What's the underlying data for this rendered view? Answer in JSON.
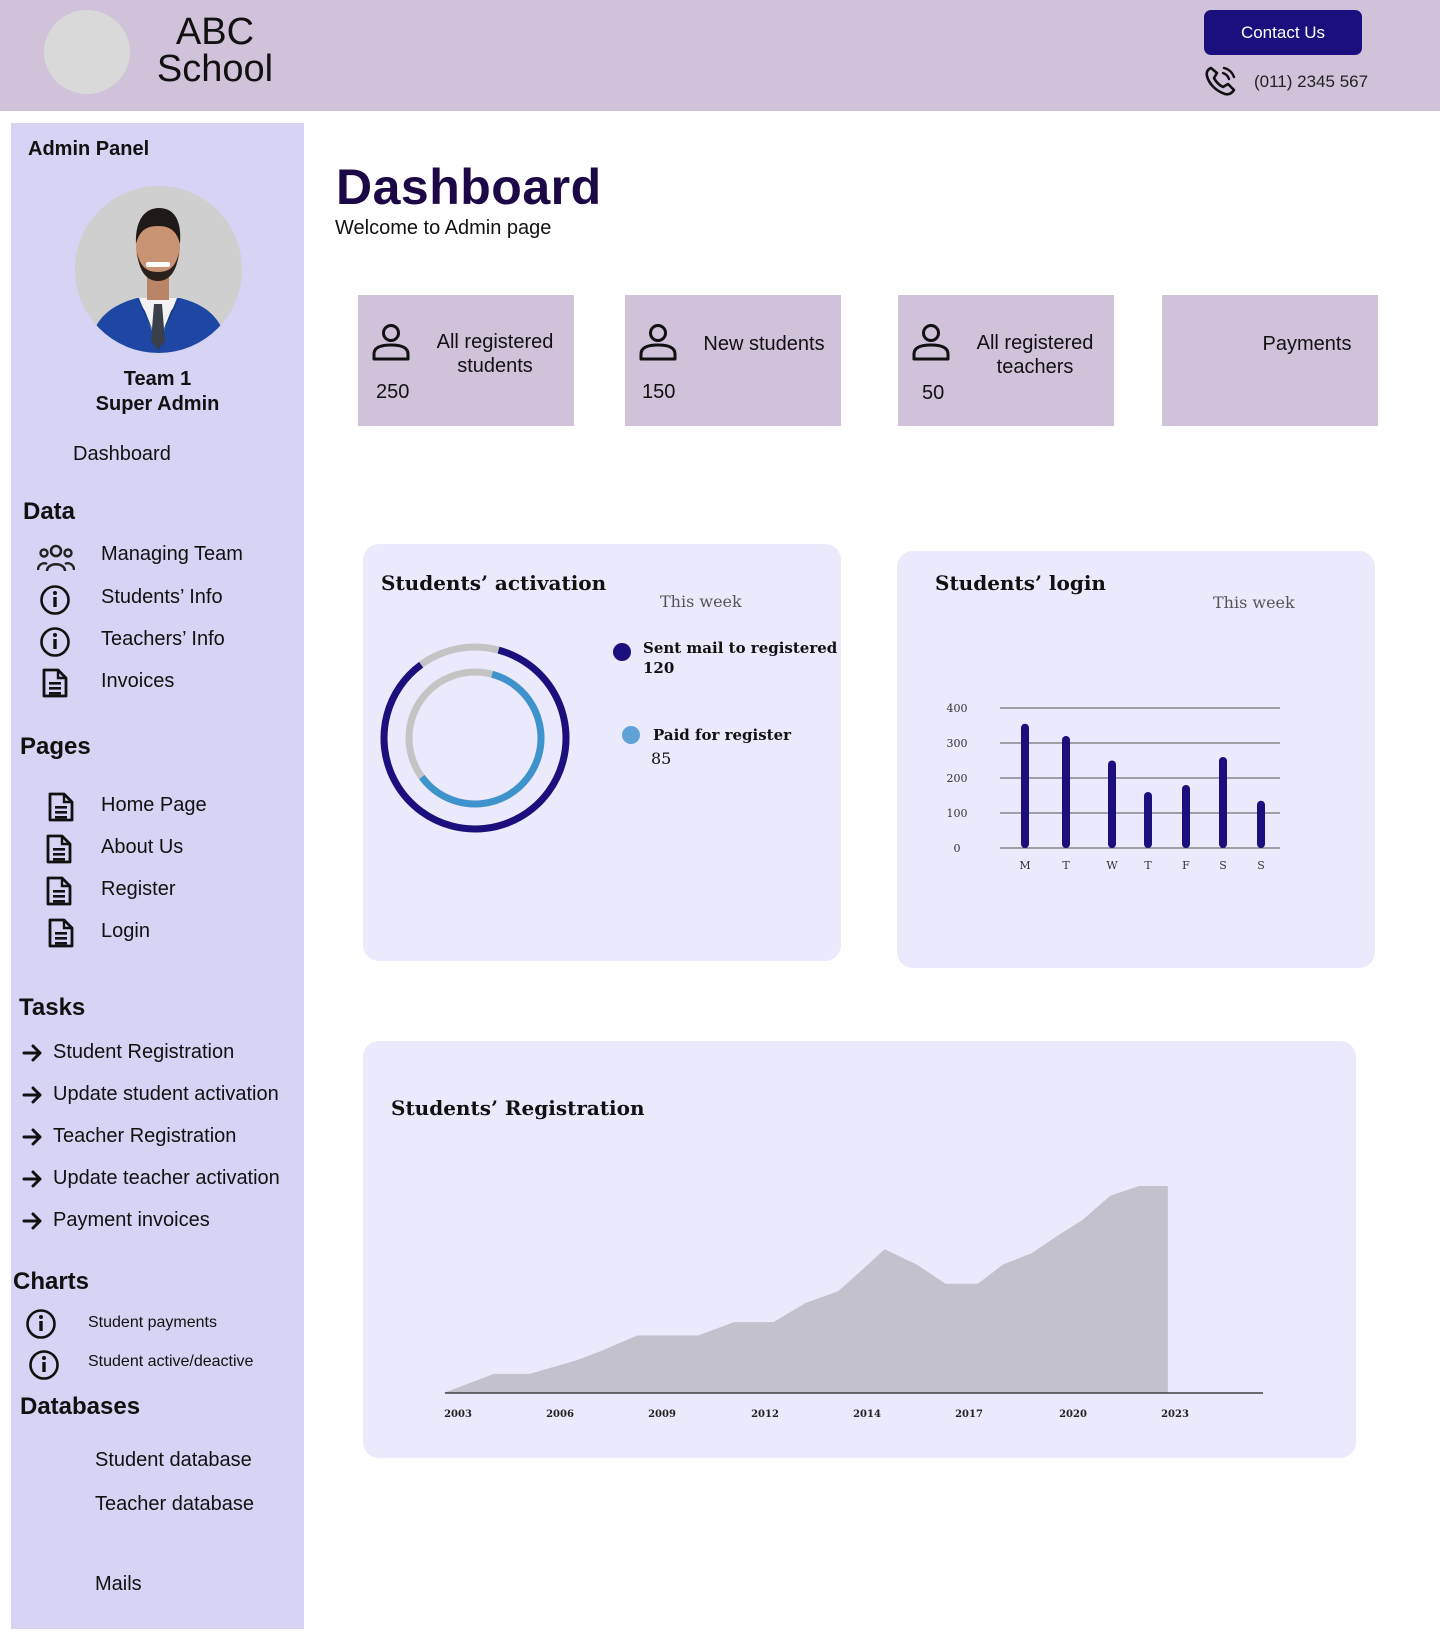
{
  "header": {
    "school_name": "ABC School",
    "contact_button": "Contact Us",
    "phone": "(011) 2345 567"
  },
  "sidebar": {
    "panel_title": "Admin Panel",
    "user_team": "Team 1",
    "user_role": "Super Admin",
    "dashboard_link": "Dashboard",
    "data_heading": "Data",
    "data_items": [
      "Managing Team",
      "Students’ Info",
      "Teachers’ Info",
      "Invoices"
    ],
    "pages_heading": "Pages",
    "pages_items": [
      "Home Page",
      "About Us",
      "Register",
      "Login"
    ],
    "tasks_heading": "Tasks",
    "tasks_items": [
      "Student Registration",
      "Update student activation",
      "Teacher Registration",
      "Update teacher activation",
      "Payment invoices"
    ],
    "charts_heading": "Charts",
    "charts_items": [
      "Student payments",
      "Student active/deactive"
    ],
    "databases_heading": "Databases",
    "databases_items": [
      "Student database",
      "Teacher database",
      "Mails"
    ]
  },
  "main": {
    "title": "Dashboard",
    "subtitle": "Welcome to Admin page",
    "cards": [
      {
        "label_line1": "All registered",
        "label_line2": "students",
        "value": "250"
      },
      {
        "label_line1": "New students",
        "label_line2": "",
        "value": "150"
      },
      {
        "label_line1": "All registered",
        "label_line2": "teachers",
        "value": "50"
      },
      {
        "label_line1": "Payments",
        "label_line2": "",
        "value": ""
      }
    ]
  },
  "activation": {
    "title": "Students’ activation",
    "period": "This week",
    "legend1_label": "Sent mail to registered",
    "legend1_value": "120",
    "legend2_label": "Paid for register",
    "legend2_value": "85"
  },
  "login": {
    "title": "Students’ login",
    "period": "This week"
  },
  "registration": {
    "title": "Students’ Registration"
  },
  "colors": {
    "header_bg": "#cfc2d9",
    "sidebar_bg": "#d6d3f4",
    "panel_bg": "#ebe9fc",
    "accent": "#1b0f7d",
    "light_blue": "#3f93cc",
    "area_fill": "#c3c1cc"
  },
  "chart_data": [
    {
      "type": "pie",
      "title": "Students’ activation",
      "subtitle": "This week",
      "series": [
        {
          "name": "Sent mail to registered",
          "value": 120,
          "color": "#1b0f7d"
        },
        {
          "name": "Paid for register",
          "value": 85,
          "color": "#3f93cc"
        }
      ],
      "max_value": 140
    },
    {
      "type": "bar",
      "title": "Students’ login",
      "subtitle": "This week",
      "categories": [
        "M",
        "T",
        "W",
        "T",
        "F",
        "S",
        "S"
      ],
      "values": [
        355,
        320,
        250,
        160,
        180,
        260,
        135
      ],
      "yticks": [
        "0",
        "100",
        "200",
        "300",
        "400"
      ],
      "ylim": [
        0,
        400
      ],
      "grid": true
    },
    {
      "type": "area",
      "title": "Students’ Registration",
      "xticks": [
        "2003",
        "2006",
        "2009",
        "2012",
        "2014",
        "2017",
        "2020",
        "2023"
      ],
      "x": [
        2002.6,
        2004.0,
        2005.0,
        2006.3,
        2007.0,
        2008.0,
        2009.7,
        2010.7,
        2011.8,
        2012.7,
        2013.6,
        2014.2,
        2014.9,
        2015.8,
        2016.6,
        2017.5,
        2018.2,
        2019.0,
        2019.8,
        2020.4,
        2021.2,
        2022.0,
        2022.8
      ],
      "values": [
        0,
        10,
        10,
        17,
        22,
        30,
        30,
        37,
        37,
        47,
        53,
        63,
        75,
        67,
        57,
        57,
        67,
        73,
        83,
        90,
        103,
        108,
        108
      ],
      "ylim": [
        0,
        120
      ]
    }
  ]
}
